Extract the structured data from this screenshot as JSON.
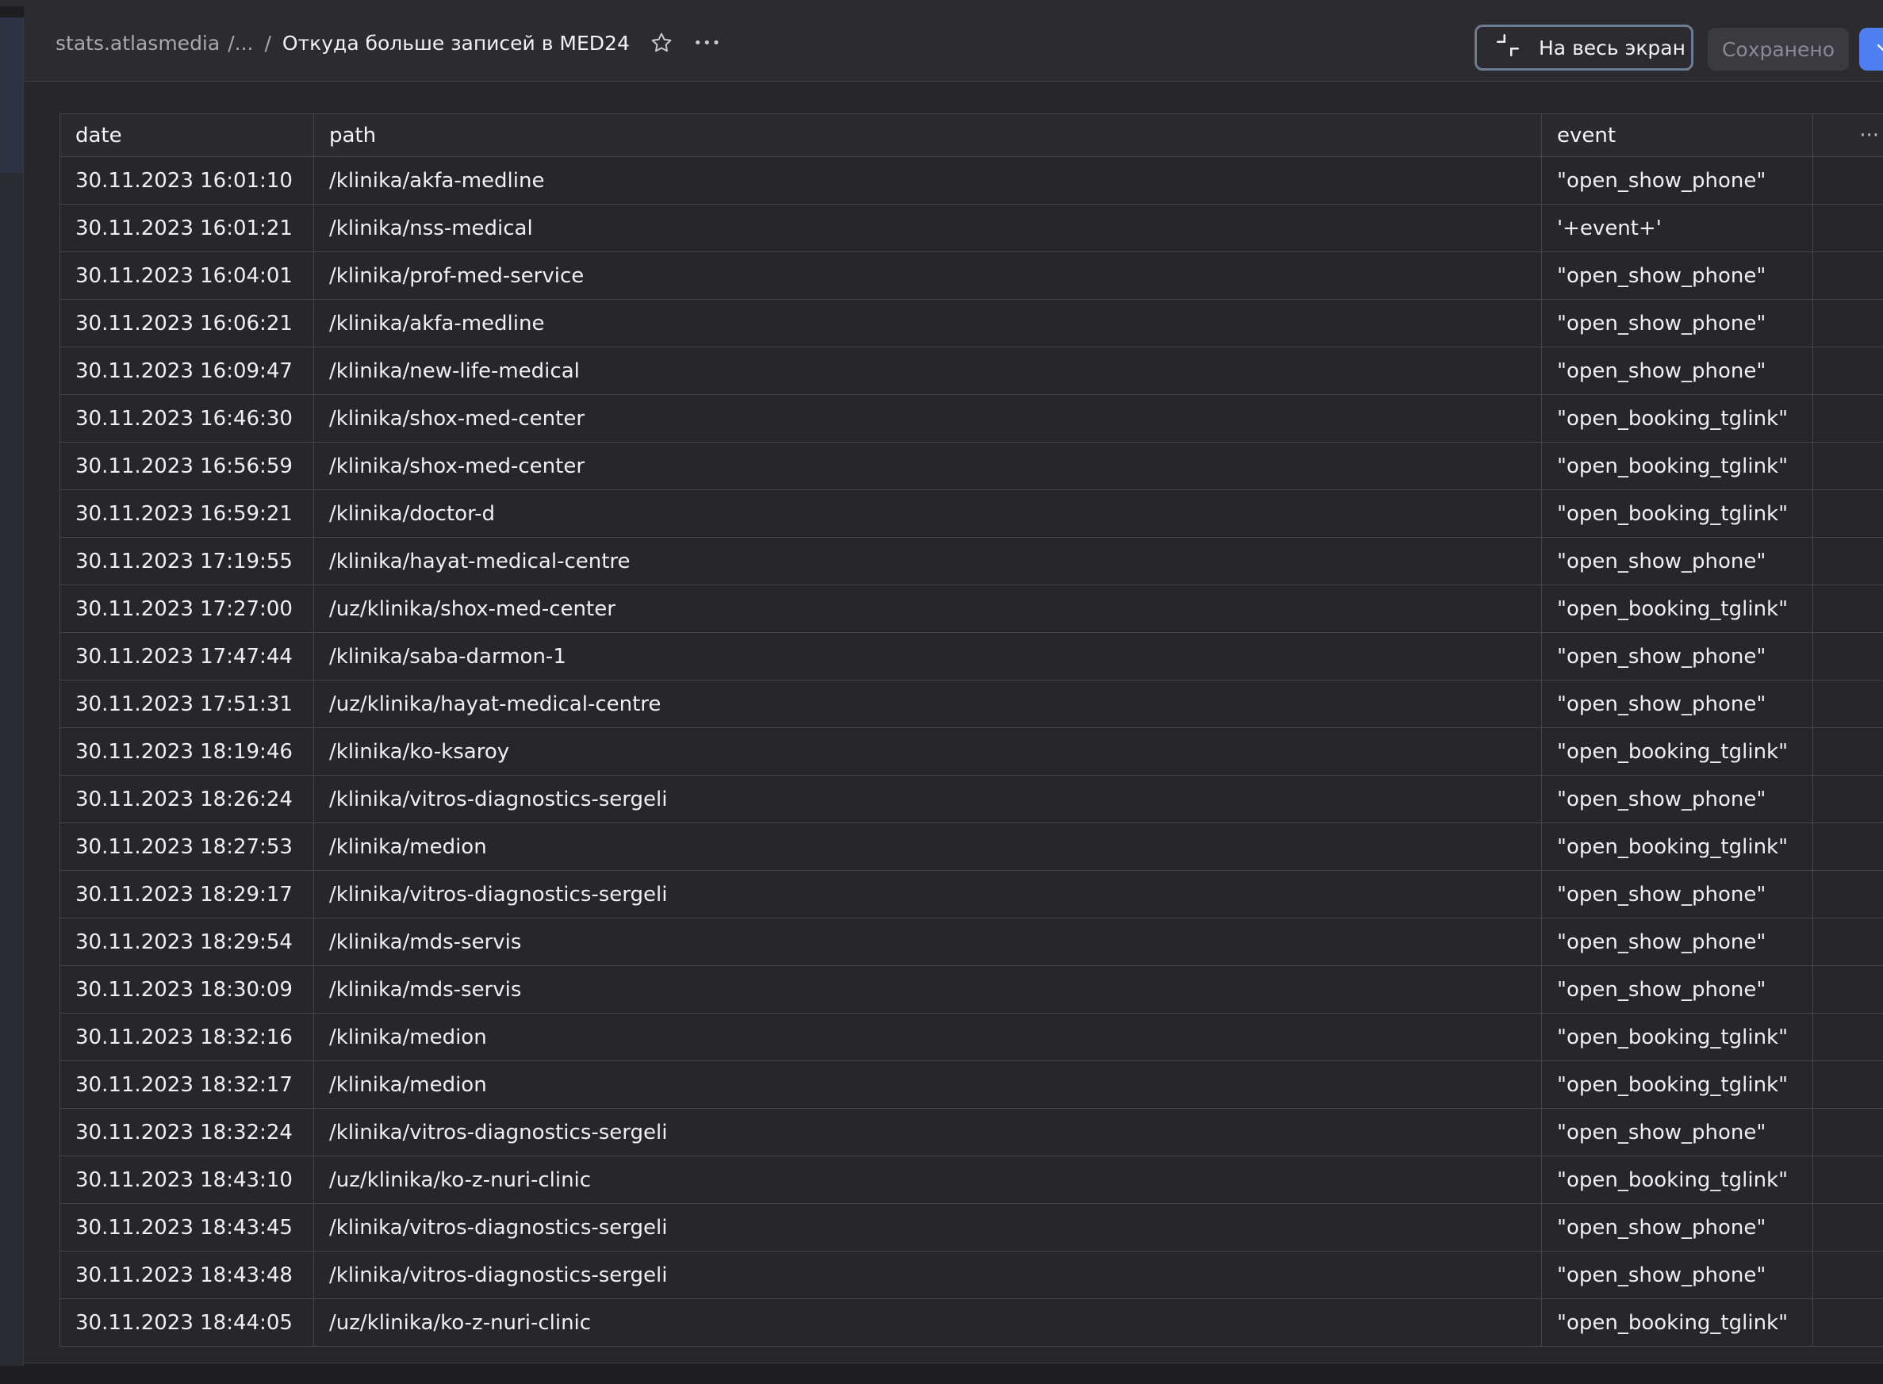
{
  "header": {
    "breadcrumb_root": "stats.atlasmedia",
    "breadcrumb_ellipsis": "/...",
    "breadcrumb_sep": "/",
    "title": "Откуда больше записей в MED24",
    "fullscreen_label": "На весь экран",
    "saved_label": "Сохранено",
    "more_symbol": "•••",
    "icons": [
      "star-icon",
      "more-icon",
      "minimize-icon",
      "chevron-down-icon"
    ]
  },
  "table": {
    "columns": [
      "date",
      "path",
      "event"
    ],
    "more_symbol": "···",
    "rows": [
      [
        "30.11.2023 16:01:10",
        "/klinika/akfa-medline",
        "\"open_show_phone\""
      ],
      [
        "30.11.2023 16:01:21",
        "/klinika/nss-medical",
        "'+event+'"
      ],
      [
        "30.11.2023 16:04:01",
        "/klinika/prof-med-service",
        "\"open_show_phone\""
      ],
      [
        "30.11.2023 16:06:21",
        "/klinika/akfa-medline",
        "\"open_show_phone\""
      ],
      [
        "30.11.2023 16:09:47",
        "/klinika/new-life-medical",
        "\"open_show_phone\""
      ],
      [
        "30.11.2023 16:46:30",
        "/klinika/shox-med-center",
        "\"open_booking_tglink\""
      ],
      [
        "30.11.2023 16:56:59",
        "/klinika/shox-med-center",
        "\"open_booking_tglink\""
      ],
      [
        "30.11.2023 16:59:21",
        "/klinika/doctor-d",
        "\"open_booking_tglink\""
      ],
      [
        "30.11.2023 17:19:55",
        "/klinika/hayat-medical-centre",
        "\"open_show_phone\""
      ],
      [
        "30.11.2023 17:27:00",
        "/uz/klinika/shox-med-center",
        "\"open_booking_tglink\""
      ],
      [
        "30.11.2023 17:47:44",
        "/klinika/saba-darmon-1",
        "\"open_show_phone\""
      ],
      [
        "30.11.2023 17:51:31",
        "/uz/klinika/hayat-medical-centre",
        "\"open_show_phone\""
      ],
      [
        "30.11.2023 18:19:46",
        "/klinika/ko-ksaroy",
        "\"open_booking_tglink\""
      ],
      [
        "30.11.2023 18:26:24",
        "/klinika/vitros-diagnostics-sergeli",
        "\"open_show_phone\""
      ],
      [
        "30.11.2023 18:27:53",
        "/klinika/medion",
        "\"open_booking_tglink\""
      ],
      [
        "30.11.2023 18:29:17",
        "/klinika/vitros-diagnostics-sergeli",
        "\"open_show_phone\""
      ],
      [
        "30.11.2023 18:29:54",
        "/klinika/mds-servis",
        "\"open_show_phone\""
      ],
      [
        "30.11.2023 18:30:09",
        "/klinika/mds-servis",
        "\"open_show_phone\""
      ],
      [
        "30.11.2023 18:32:16",
        "/klinika/medion",
        "\"open_booking_tglink\""
      ],
      [
        "30.11.2023 18:32:17",
        "/klinika/medion",
        "\"open_booking_tglink\""
      ],
      [
        "30.11.2023 18:32:24",
        "/klinika/vitros-diagnostics-sergeli",
        "\"open_show_phone\""
      ],
      [
        "30.11.2023 18:43:10",
        "/uz/klinika/ko-z-nuri-clinic",
        "\"open_booking_tglink\""
      ],
      [
        "30.11.2023 18:43:45",
        "/klinika/vitros-diagnostics-sergeli",
        "\"open_show_phone\""
      ],
      [
        "30.11.2023 18:43:48",
        "/klinika/vitros-diagnostics-sergeli",
        "\"open_show_phone\""
      ],
      [
        "30.11.2023 18:44:05",
        "/uz/klinika/ko-z-nuri-clinic",
        "\"open_booking_tglink\""
      ]
    ]
  },
  "colors": {
    "background": "#26262b",
    "header": "#2b2b30",
    "grid": "#45454b",
    "accent": "#4f7df2",
    "fullscreen_border": "#6b7d93"
  }
}
